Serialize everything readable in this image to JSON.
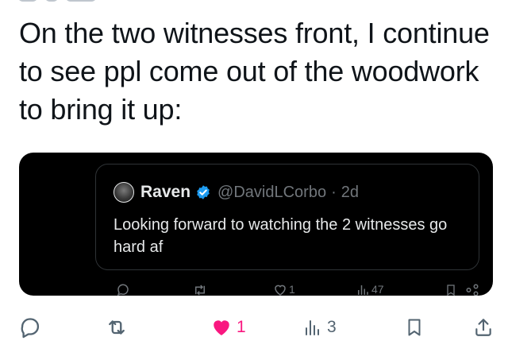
{
  "tweet": {
    "text": "On the two witnesses front, I continue to see ppl come out of the woodwork to bring it up:"
  },
  "quoted_tweet": {
    "name": "Raven",
    "handle": "@DavidLCorbo",
    "separator": "·",
    "time": "2d",
    "text": "Looking forward to watching the 2 witnesses go hard af",
    "verified_color": "#1d9bf0",
    "embedded_actions": {
      "like_count": "1",
      "views_count": "47"
    }
  },
  "actions": {
    "reply_icon": "reply-icon",
    "retweet_icon": "retweet-icon",
    "like_icon": "heart-filled-icon",
    "like_count": "1",
    "views_icon": "views-chart-icon",
    "views_count": "3",
    "bookmark_icon": "bookmark-icon",
    "share_icon": "share-icon"
  },
  "colors": {
    "text": "#0f1419",
    "muted": "#536471",
    "like": "#f91880",
    "embed_bg": "#000000",
    "embed_border": "#2f3336"
  }
}
